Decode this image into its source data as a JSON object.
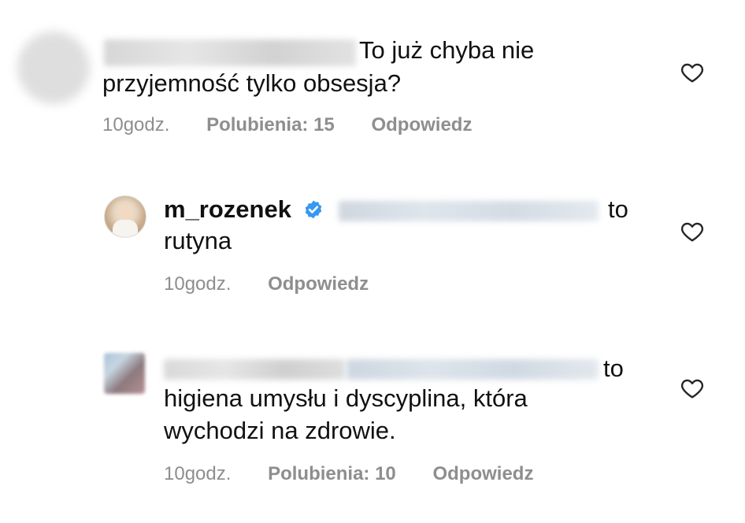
{
  "comments": [
    {
      "line1_after_name": "To już chyba nie",
      "line2": "przyjemność  tylko obsesja?",
      "time": "10godz.",
      "likes": "Polubienia: 15",
      "reply": "Odpowiedz"
    },
    {
      "username": "m_rozenek",
      "line1_after_name": "to",
      "line2": "rutyna",
      "time": "10godz.",
      "reply": "Odpowiedz"
    },
    {
      "line1_after_name": "to",
      "line2": "higiena umysłu i dyscyplina, która",
      "line3": "wychodzi na zdrowie.",
      "time": "10godz.",
      "likes": "Polubienia: 10",
      "reply": "Odpowiedz"
    }
  ],
  "icons": {
    "like": "heart-outline-icon",
    "verified": "verified-badge-icon"
  },
  "colors": {
    "meta": "#8e8e8e",
    "verified": "#3897f0",
    "text": "#111111"
  }
}
